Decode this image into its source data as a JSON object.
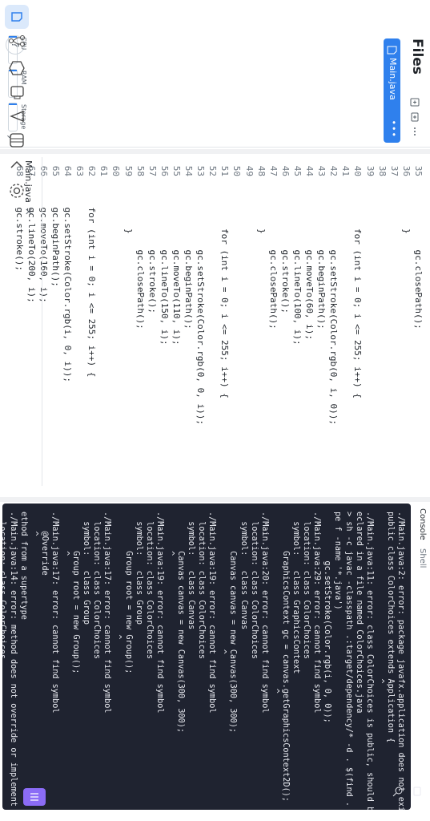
{
  "sidebar": {
    "title": "Files",
    "file_name": "Main.java",
    "more": "•••"
  },
  "meters": {
    "cpu": "CPU",
    "ram": "RAM",
    "storage": "Storage",
    "expand": "›"
  },
  "editor": {
    "tab_label": "Main.java",
    "tab_close": "×",
    "lines": [
      {
        "n": "35",
        "t": "            gc.closePath();"
      },
      {
        "n": "36",
        "t": "        }"
      },
      {
        "n": "37",
        "t": ""
      },
      {
        "n": "38",
        "t": ""
      },
      {
        "n": "39",
        "t": ""
      },
      {
        "n": "40",
        "t": "        for (int i = 0; i <= 255; i++) {"
      },
      {
        "n": "41",
        "t": ""
      },
      {
        "n": "42",
        "t": "            gc.setStroke(Color.rgb(0, i, 0));"
      },
      {
        "n": "43",
        "t": "            gc.beginPath();"
      },
      {
        "n": "44",
        "t": "            gc.moveTo(60, i);"
      },
      {
        "n": "45",
        "t": "            gc.lineTo(100, i);"
      },
      {
        "n": "46",
        "t": "            gc.stroke();"
      },
      {
        "n": "47",
        "t": "            gc.closePath();"
      },
      {
        "n": "48",
        "t": "        }"
      },
      {
        "n": "49",
        "t": ""
      },
      {
        "n": "50",
        "t": ""
      },
      {
        "n": "51",
        "t": "        for (int i = 0; i <= 255; i++) {"
      },
      {
        "n": "52",
        "t": ""
      },
      {
        "n": "53",
        "t": "            gc.setStroke(Color.rgb(0, 0, i));"
      },
      {
        "n": "54",
        "t": "            gc.beginPath();"
      },
      {
        "n": "55",
        "t": "            gc.moveTo(110, i);"
      },
      {
        "n": "56",
        "t": "            gc.lineTo(150, i);"
      },
      {
        "n": "57",
        "t": "            gc.stroke();"
      },
      {
        "n": "58",
        "t": "            gc.closePath();"
      },
      {
        "n": "59",
        "t": "        }"
      },
      {
        "n": "60",
        "t": ""
      },
      {
        "n": "61",
        "t": ""
      },
      {
        "n": "62",
        "t": "    for (int i = 0; i <= 255; i++) {"
      },
      {
        "n": "63",
        "t": ""
      },
      {
        "n": "64",
        "t": "    gc.setStroke(Color.rgb(i, 0, i));"
      },
      {
        "n": "65",
        "t": "    gc.beginPath();"
      },
      {
        "n": "66",
        "t": "    gc.moveTo(160, i);"
      },
      {
        "n": "67",
        "t": "    gc.lineTo(200, i);"
      },
      {
        "n": "68",
        "t": "    gc.stroke();"
      }
    ]
  },
  "console": {
    "tab_console": "Console",
    "tab_shell": "Shell",
    "output": "./Main.java:2: error: package javafx.application does not exist\npublic class ColorChoices extends Application {\n                                  ^\n./Main.java:11: error: class ColorChoices is public, should be d\neclared in a file named ColorChoices.java\n> sh -c javac -classpath .:target/dependency/* -d . $(find . -ty\npe f -name '*.java')\n          gc.setStroke(Color.rgb(i, 0, 0));\n./Main.java:29: error: cannot find symbol\n  location: class ColorChoices\n  symbol:   class GraphicsContext\n        GraphicsContext gc = canvas.getGraphicsContext2D();\n                                    ^\n./Main.java:20: error: cannot find symbol\n  location: class ColorChoices\n  symbol:   class Canvas\n        Canvas canvas = new Canvas(300, 300);\n                            ^\n./Main.java:19: error: cannot find symbol\n  location: class ColorChoices\n  symbol:   class Canvas\n        Canvas canvas = new Canvas(300, 300);\n        ^\n./Main.java:19: error: cannot find symbol\n  location: class ColorChoices\n  symbol:   class Group\n        Group root = new Group();\n                         ^\n./Main.java:17: error: cannot find symbol\n  location: class ColorChoices\n  symbol:   class Group\n        Group root = new Group();\n        ^\n./Main.java:17: error: cannot find symbol\n    @Override\n    ^\nethod from a supertype\n./Main.java:14: error: method does not override or implement a m\n  location: class ColorChoices\n  symbol:   class Stage\n                      ^"
  },
  "colors": {
    "accent": "#2f80ed",
    "console_bg": "#1f2330",
    "purple": "#8b6cf6"
  }
}
